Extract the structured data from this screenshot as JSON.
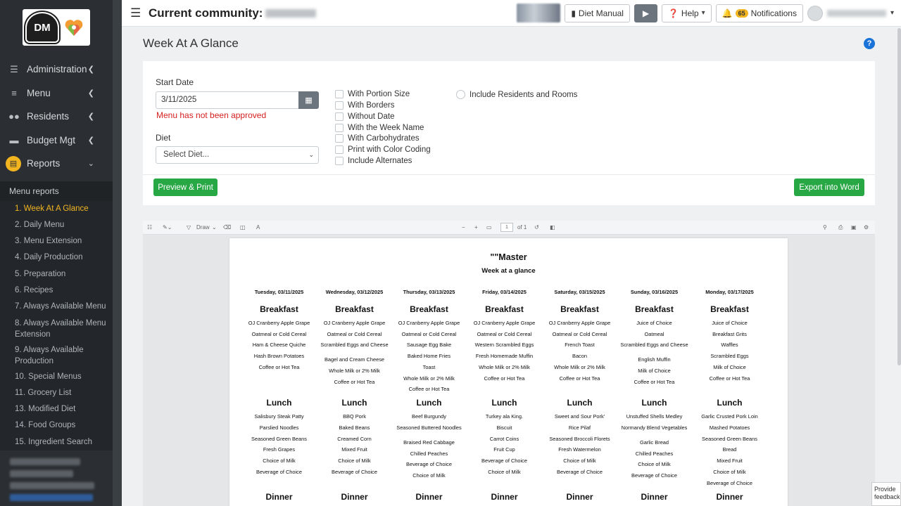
{
  "sidebar": {
    "logo_text": "DM",
    "nav": [
      {
        "label": "Administration",
        "icon": "sliders-icon"
      },
      {
        "label": "Menu",
        "icon": "list-icon"
      },
      {
        "label": "Residents",
        "icon": "users-icon"
      },
      {
        "label": "Budget Mgt",
        "icon": "wallet-icon"
      },
      {
        "label": "Reports",
        "icon": "report-icon"
      }
    ],
    "sub_heading": "Menu reports",
    "reports": [
      "1. Week At A Glance",
      "2. Daily Menu",
      "3. Menu Extension",
      "4. Daily Production",
      "5. Preparation",
      "6. Recipes",
      "7. Always Available Menu",
      "8. Always Available Menu Extension",
      "9. Always Available Production",
      "10. Special Menus",
      "11. Grocery List",
      "13. Modified Diet",
      "14. Food Groups",
      "15. Ingredient Search"
    ]
  },
  "topbar": {
    "community_label": "Current community:",
    "diet_manual": "Diet Manual",
    "help": "Help",
    "notifications": "Notifications",
    "notif_count": "65"
  },
  "page": {
    "title": "Week At A Glance",
    "start_date_label": "Start Date",
    "start_date_value": "3/11/2025",
    "error_text": "Menu has not been approved",
    "diet_label": "Diet",
    "diet_placeholder": "Select Diet...",
    "options": [
      "With Portion Size",
      "With Borders",
      "Without Date",
      "With the Week Name",
      "With Carbohydrates",
      "Print with Color Coding",
      "Include Alternates"
    ],
    "radio_label": "Include Residents and Rooms",
    "preview_button": "Preview & Print",
    "export_button": "Export into Word"
  },
  "viewer": {
    "draw_label": "Draw",
    "page_number": "1",
    "page_of": "of 1"
  },
  "document": {
    "title": "\"\"Master",
    "subtitle": "Week at a glance",
    "days": [
      {
        "date": "Tuesday, 03/11/2025",
        "breakfast": [
          "OJ Cranberry Apple Grape",
          "Oatmeal or Cold Cereal",
          "Ham & Cheese Quiche",
          "Hash Brown Potatoes",
          "Coffee or Hot Tea"
        ],
        "lunch": [
          "Salisbury Steak Patty",
          "Parslied Noodles",
          "Seasoned Green Beans",
          "Fresh Grapes",
          "Choice of Milk",
          "Beverage of Choice"
        ]
      },
      {
        "date": "Wednesday, 03/12/2025",
        "breakfast": [
          "OJ Cranberry Apple Grape",
          "Oatmeal or Cold Cereal",
          "Scrambled Eggs and Cheese",
          "Bagel and Cream Cheese",
          "Whole Milk or 2% Milk",
          "Coffee or Hot Tea"
        ],
        "lunch": [
          "BBQ Pork",
          "Baked Beans",
          "Creamed Corn",
          "Mixed Fruit",
          "Choice of Milk",
          "Beverage of Choice"
        ]
      },
      {
        "date": "Thursday, 03/13/2025",
        "breakfast": [
          "OJ Cranberry Apple Grape",
          "Oatmeal or Cold Cereal",
          "Sausage Egg Bake",
          "Baked Home Fries",
          "Toast",
          "Whole Milk or 2% Milk",
          "Coffee or Hot Tea"
        ],
        "lunch": [
          "Beef Burgundy",
          "Seasoned Buttered Noodles",
          "Braised Red Cabbage",
          "Chilled Peaches",
          "Beverage of Choice",
          "Choice of Milk"
        ]
      },
      {
        "date": "Friday, 03/14/2025",
        "breakfast": [
          "OJ Cranberry Apple Grape",
          "Oatmeal or Cold Cereal",
          "Western Scrambled Eggs",
          "Fresh Homemade Muffin",
          "Whole Milk or 2% Milk",
          "Coffee or Hot Tea"
        ],
        "lunch": [
          "Turkey ala King.",
          "Biscuit",
          "Carrot Coins",
          "Fruit Cup",
          "Beverage of Choice",
          "Choice of Milk"
        ]
      },
      {
        "date": "Saturday, 03/15/2025",
        "breakfast": [
          "OJ Cranberry Apple Grape",
          "Oatmeal or Cold Cereal",
          "French Toast",
          "Bacon",
          "Whole Milk or 2% Milk",
          "Coffee or Hot Tea"
        ],
        "lunch": [
          "Sweet and Sour Pork'",
          "Rice Pilaf",
          "Seasoned Broccoli Florets",
          "Fresh Watermelon",
          "Choice of Milk",
          "Beverage of Choice"
        ]
      },
      {
        "date": "Sunday, 03/16/2025",
        "breakfast": [
          "Juice of Choice",
          "Oatmeal",
          "Scrambled Eggs and Cheese",
          "English Muffin",
          "Milk of Choice",
          "Coffee or Hot Tea"
        ],
        "lunch": [
          "Unstuffed Shells Medley",
          "Normandy Blend Vegetables",
          "Garlic Bread",
          "Chilled Peaches",
          "Choice of Milk",
          "Beverage of Choice"
        ]
      },
      {
        "date": "Monday, 03/17/2025",
        "breakfast": [
          "Juice of Choice",
          "Breakfast Grits",
          "Waffles",
          "Scrambled Eggs",
          "Milk of Choice",
          "Coffee or Hot Tea"
        ],
        "lunch": [
          "Garlic Crusted Pork Loin",
          "Mashed Potatoes",
          "Seasoned Green Beans",
          "Bread",
          "Mixed Fruit",
          "Choice of Milk",
          "Beverage of Choice"
        ]
      }
    ],
    "meal_labels": {
      "breakfast": "Breakfast",
      "lunch": "Lunch",
      "dinner": "Dinner"
    }
  },
  "feedback": "Provide feedback"
}
